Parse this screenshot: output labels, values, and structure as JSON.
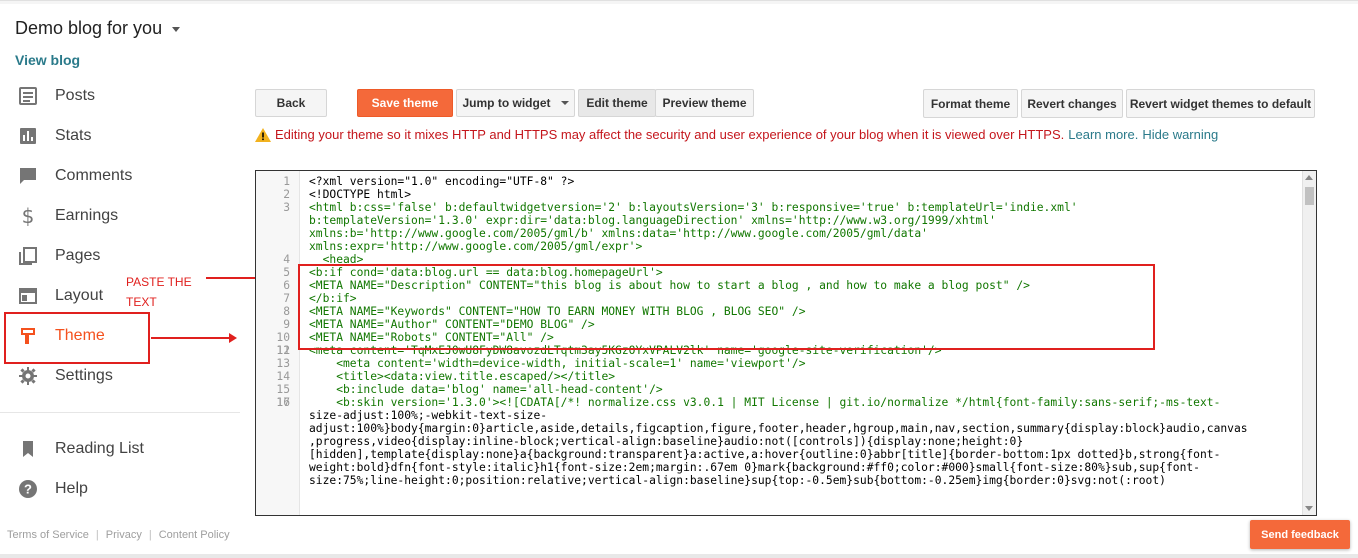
{
  "header": {
    "blog_title": "Demo blog for you",
    "view_blog": "View blog"
  },
  "nav": {
    "items": [
      {
        "label": "Posts",
        "icon": "posts-icon"
      },
      {
        "label": "Stats",
        "icon": "stats-icon"
      },
      {
        "label": "Comments",
        "icon": "comments-icon"
      },
      {
        "label": "Earnings",
        "icon": "earnings-icon"
      },
      {
        "label": "Pages",
        "icon": "pages-icon"
      },
      {
        "label": "Layout",
        "icon": "layout-icon"
      },
      {
        "label": "Theme",
        "icon": "theme-icon",
        "active": true
      },
      {
        "label": "Settings",
        "icon": "settings-icon"
      }
    ],
    "secondary": [
      {
        "label": "Reading List",
        "icon": "bookmark-icon"
      },
      {
        "label": "Help",
        "icon": "help-icon"
      }
    ]
  },
  "footer": {
    "terms": "Terms of Service",
    "privacy": "Privacy",
    "content_policy": "Content Policy"
  },
  "annotation": {
    "line1": "PASTE THE",
    "line2": "TEXT"
  },
  "toolbar": {
    "back": "Back",
    "save_theme": "Save theme",
    "jump_to_widget": "Jump to widget",
    "edit_theme": "Edit theme",
    "preview_theme": "Preview theme",
    "format_theme": "Format theme",
    "revert_changes": "Revert changes",
    "revert_widget_themes": "Revert widget themes to default"
  },
  "warning": {
    "message": "Editing your theme so it mixes HTTP and HTTPS may affect the security and user experience of your blog when it is viewed over HTTPS.",
    "learn_more": "Learn more.",
    "hide": "Hide warning"
  },
  "editor": {
    "lines": [
      {
        "n": "1",
        "text": "<?xml version=\"1.0\" encoding=\"UTF-8\" ?>",
        "cls": ""
      },
      {
        "n": "2",
        "text": "<!DOCTYPE html>",
        "cls": ""
      },
      {
        "n": "3",
        "text": "<html b:css='false' b:defaultwidgetversion='2' b:layoutsVersion='3' b:responsive='true' b:templateUrl='indie.xml'",
        "cls": "tag"
      },
      {
        "n": "",
        "text": "b:templateVersion='1.3.0' expr:dir='data:blog.languageDirection' xmlns='http://www.w3.org/1999/xhtml'",
        "cls": "tag"
      },
      {
        "n": "",
        "text": "xmlns:b='http://www.google.com/2005/gml/b' xmlns:data='http://www.google.com/2005/gml/data'",
        "cls": "tag"
      },
      {
        "n": "",
        "text": "xmlns:expr='http://www.google.com/2005/gml/expr'>",
        "cls": "tag"
      },
      {
        "n": "4",
        "text": "  <head>",
        "cls": "tag"
      },
      {
        "n": "5",
        "text": "<b:if cond='data:blog.url == data:blog.homepageUrl'>",
        "cls": "tag"
      },
      {
        "n": "6",
        "text": "<META NAME=\"Description\" CONTENT=\"this blog is about how to start a blog , and how to make a blog post\" />",
        "cls": "tag"
      },
      {
        "n": "7",
        "text": "</b:if>",
        "cls": "tag"
      },
      {
        "n": "8",
        "text": "<META NAME=\"Keywords\" CONTENT=\"HOW TO EARN MONEY WITH BLOG , BLOG SEO\" />",
        "cls": "tag"
      },
      {
        "n": "9",
        "text": "<META NAME=\"Author\" CONTENT=\"DEMO BLOG\" />",
        "cls": "tag"
      },
      {
        "n": "10",
        "text": "<META NAME=\"Robots\" CONTENT=\"All\" />",
        "cls": "tag"
      },
      {
        "n": "11",
        "text": "",
        "cls": ""
      },
      {
        "n": "12",
        "text": "<meta content='TqMxEJ0wU8FyDW8avozdLTqtm3ay5KGzOYxVPALV2lk' name='google-site-verification'/>",
        "cls": "tag"
      },
      {
        "n": "13",
        "text": "    <meta content='width=device-width, initial-scale=1' name='viewport'/>",
        "cls": "tag"
      },
      {
        "n": "14",
        "text": "    <title><data:view.title.escaped/></title>",
        "cls": "tag"
      },
      {
        "n": "15",
        "text": "    <b:include data='blog' name='all-head-content'/>",
        "cls": "tag"
      },
      {
        "n": "16",
        "text": "",
        "cls": ""
      },
      {
        "n": "17",
        "text": "    <b:skin version='1.3.0'><![CDATA[/*! normalize.css v3.0.1 | MIT License | git.io/normalize */html{font-family:sans-serif;-ms-text-",
        "cls": "tag"
      },
      {
        "n": "",
        "text": "size-adjust:100%;-webkit-text-size-",
        "cls": "cont"
      },
      {
        "n": "",
        "text": "adjust:100%}body{margin:0}article,aside,details,figcaption,figure,footer,header,hgroup,main,nav,section,summary{display:block}audio,canvas",
        "cls": "cont"
      },
      {
        "n": "",
        "text": ",progress,video{display:inline-block;vertical-align:baseline}audio:not([controls]){display:none;height:0}",
        "cls": "cont"
      },
      {
        "n": "",
        "text": "[hidden],template{display:none}a{background:transparent}a:active,a:hover{outline:0}abbr[title]{border-bottom:1px dotted}b,strong{font-",
        "cls": "cont"
      },
      {
        "n": "",
        "text": "weight:bold}dfn{font-style:italic}h1{font-size:2em;margin:.67em 0}mark{background:#ff0;color:#000}small{font-size:80%}sub,sup{font-",
        "cls": "cont"
      },
      {
        "n": "",
        "text": "size:75%;line-height:0;position:relative;vertical-align:baseline}sup{top:-0.5em}sub{bottom:-0.25em}img{border:0}svg:not(:root)",
        "cls": "cont"
      }
    ]
  },
  "feedback": "Send feedback",
  "colors": {
    "accent": "#f4693a",
    "link": "#2a7a8a",
    "warning": "#c4161c",
    "annotation": "#e0201e"
  }
}
